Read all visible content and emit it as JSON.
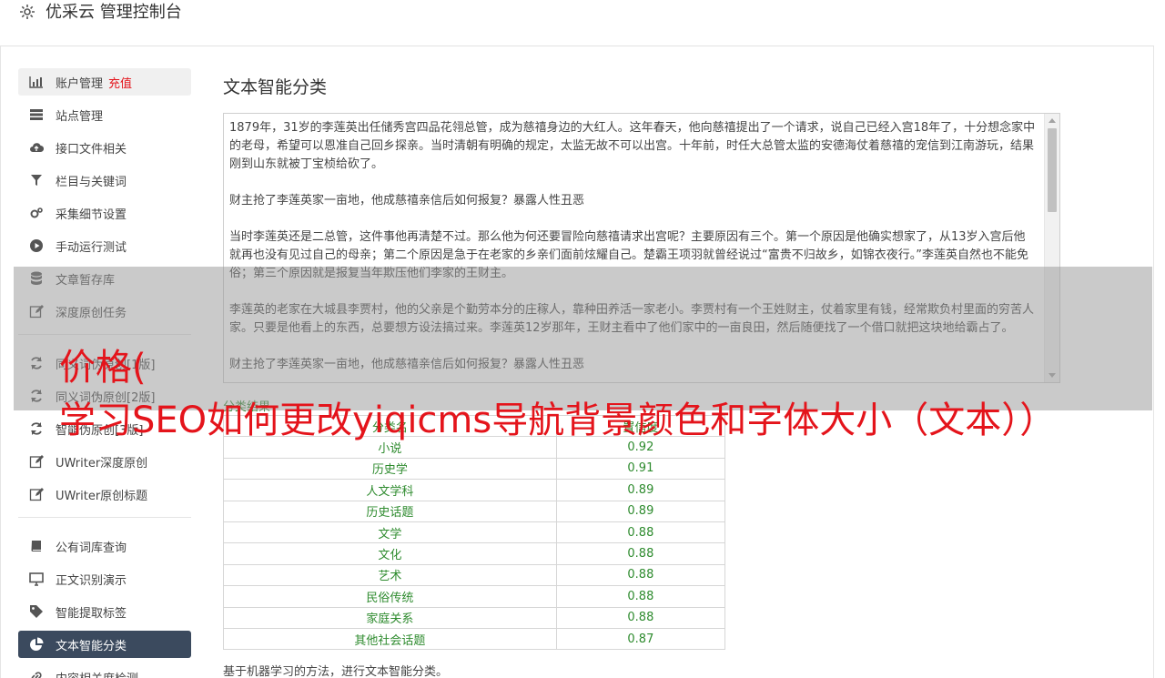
{
  "app": {
    "title": "优采云 管理控制台"
  },
  "sidebar": {
    "items": [
      {
        "label": "账户管理",
        "badge": "充值",
        "icon": "bar-chart-icon"
      },
      {
        "label": "站点管理",
        "icon": "server-icon"
      },
      {
        "label": "接口文件相关",
        "icon": "cloud-upload-icon"
      },
      {
        "label": "栏目与关键词",
        "icon": "filter-icon"
      },
      {
        "label": "采集细节设置",
        "icon": "gears-icon"
      },
      {
        "label": "手动运行测试",
        "icon": "play-circle-icon"
      },
      {
        "label": "文章暂存库",
        "icon": "database-icon"
      },
      {
        "label": "深度原创任务",
        "icon": "edit-icon"
      }
    ],
    "items2": [
      {
        "label": "同义词伪原创[1版]",
        "icon": "refresh-icon"
      },
      {
        "label": "同义词伪原创[2版]",
        "icon": "refresh-icon"
      },
      {
        "label": "智能伪原创[3版]",
        "icon": "refresh-icon"
      },
      {
        "label": "UWriter深度原创",
        "icon": "edit-icon"
      },
      {
        "label": "UWriter原创标题",
        "icon": "edit-icon"
      }
    ],
    "items3": [
      {
        "label": "公有词库查询",
        "icon": "book-icon"
      },
      {
        "label": "正文识别演示",
        "icon": "desktop-icon"
      },
      {
        "label": "智能提取标签",
        "icon": "tag-icon"
      },
      {
        "label": "文本智能分类",
        "icon": "pie-chart-icon"
      },
      {
        "label": "内容相关度检测",
        "icon": "link-icon"
      }
    ]
  },
  "main": {
    "title": "文本智能分类",
    "paragraphs": [
      "1879年，31岁的李莲英出任储秀宫四品花翎总管，成为慈禧身边的大红人。这年春天，他向慈禧提出了一个请求，说自己已经入宫18年了，十分想念家中的老母，希望可以恩准自己回乡探亲。当时清朝有明确的规定，太监无故不可以出宫。十年前，时任大总管太监的安德海仗着慈禧的宠信到江南游玩，结果刚到山东就被丁宝桢给砍了。",
      "财主抢了李莲英家一亩地，他成慈禧亲信后如何报复？暴露人性丑恶",
      "当时李莲英还是二总管，这件事他再清楚不过。那么他为何还要冒险向慈禧请求出宫呢？主要原因有三个。第一个原因是他确实想家了，从13岁入宫后他就再也没有见过自己的母亲；第二个原因是急于在老家的乡亲们面前炫耀自己。楚霸王项羽就曾经说过“富贵不归故乡，如锦衣夜行。”李莲英自然也不能免俗；第三个原因就是报复当年欺压他们李家的王财主。",
      "李莲英的老家在大城县李贾村，他的父亲是个勤劳本分的庄稼人，靠种田养活一家老小。李贾村有一个王姓财主，仗着家里有钱，经常欺负村里面的穷苦人家。只要是他看上的东西，总要想方设法搞过来。李莲英12岁那年，王财主看中了他们家中的一亩良田，然后随便找了一个借口就把这块地给霸占了。",
      "财主抢了李莲英家一亩地，他成慈禧亲信后如何报复？暴露人性丑恶"
    ],
    "result_label": "分类结果",
    "table": {
      "headers": [
        "分类名",
        "置信度"
      ],
      "rows": [
        [
          "小说",
          "0.92"
        ],
        [
          "历史学",
          "0.91"
        ],
        [
          "人文学科",
          "0.89"
        ],
        [
          "历史话题",
          "0.89"
        ],
        [
          "文学",
          "0.88"
        ],
        [
          "文化",
          "0.88"
        ],
        [
          "艺术",
          "0.88"
        ],
        [
          "民俗传统",
          "0.88"
        ],
        [
          "家庭关系",
          "0.88"
        ],
        [
          "其他社会话题",
          "0.87"
        ]
      ]
    },
    "footnote": "基于机器学习的方法，进行文本智能分类。"
  },
  "overlay": {
    "line1": "价格(",
    "line2": "学习SEO如何更改yiqicms导航背景颜色和字体大小（文本））"
  },
  "colors": {
    "accent_red": "#e4141b",
    "result_green": "#2e8b2e",
    "active_dark": "#3b4a5e"
  }
}
